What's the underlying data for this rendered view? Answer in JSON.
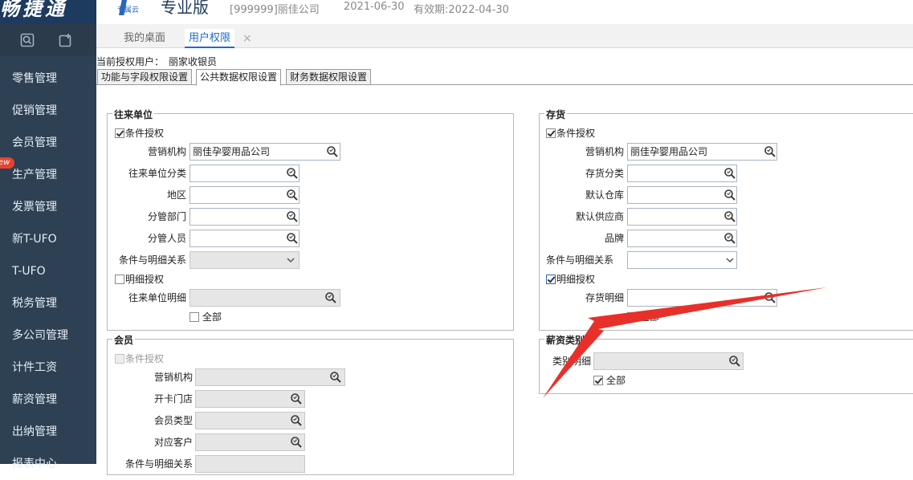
{
  "header": {
    "logo_text": "畅捷通",
    "brand_mark": "T",
    "brand_sub": "专属云",
    "edition": "专业版",
    "company": "[999999]丽佳公司",
    "date": "2021-06-30",
    "valid": "有效期:2022-04-30"
  },
  "sidebar": {
    "new_badge": "ew",
    "items": [
      "零售管理",
      "促销管理",
      "会员管理",
      "生产管理",
      "发票管理",
      "新T-UFO",
      "T-UFO",
      "税务管理",
      "多公司管理",
      "计件工资",
      "薪资管理",
      "出纳管理",
      "报表中心"
    ]
  },
  "tabs": {
    "desktop": "我的桌面",
    "perm": "用户权限",
    "close": "×"
  },
  "content": {
    "current_user_label": "当前授权用户：",
    "current_user_name": "丽家收银员",
    "sub_tabs": [
      "功能与字段权限设置",
      "公共数据权限设置",
      "财务数据权限设置"
    ],
    "partner": {
      "title": "往来单位",
      "cond_auth": "条件授权",
      "org_label": "营销机构",
      "org_value": "丽佳孕婴用品公司",
      "class_label": "往来单位分类",
      "region_label": "地区",
      "dept_label": "分管部门",
      "staff_label": "分管人员",
      "relation_label": "条件与明细关系",
      "detail_auth": "明细授权",
      "detail_label": "往来单位明细",
      "all_label": "全部"
    },
    "member": {
      "title": "会员",
      "cond_auth": "条件授权",
      "org_label": "营销机构",
      "store_label": "开卡门店",
      "type_label": "会员类型",
      "customer_label": "对应客户",
      "relation_label": "条件与明细关系"
    },
    "inventory": {
      "title": "存货",
      "cond_auth": "条件授权",
      "org_label": "营销机构",
      "org_value": "丽佳孕婴用品公司",
      "class_label": "存货分类",
      "warehouse_label": "默认仓库",
      "supplier_label": "默认供应商",
      "brand_label": "品牌",
      "relation_label": "条件与明细关系",
      "detail_auth": "明细授权",
      "detail_label": "存货明细",
      "all_label": "全部"
    },
    "salary": {
      "title": "薪资类别",
      "detail_label": "类别明细",
      "all_label": "全部"
    }
  },
  "colors": {
    "sidebar_bg": "#2e4053",
    "logo_bg": "#1d3a5f",
    "accent": "#1a6dcc",
    "annotation_arrow": "#e8302a",
    "badge": "#e8412f"
  }
}
